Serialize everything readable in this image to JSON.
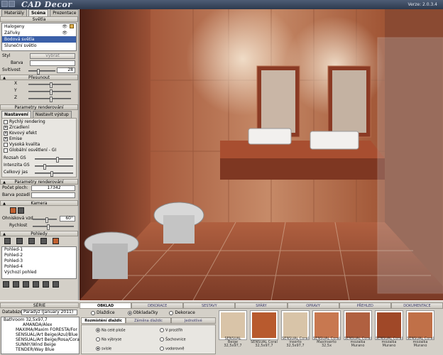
{
  "app": {
    "logo": "CAD Decor",
    "version": "Verze: 2.0.3.4"
  },
  "left": {
    "tabs": [
      {
        "label": "Materiály"
      },
      {
        "label": "Scéna"
      },
      {
        "label": "Prezentace"
      }
    ],
    "lights": {
      "header": "Světla",
      "items": [
        {
          "label": "Halogeny"
        },
        {
          "label": "Zářivky"
        },
        {
          "label": "Bodová světla"
        },
        {
          "label": "Sluneční světlo"
        }
      ]
    },
    "styl": {
      "label": "Styl",
      "button": "vybrat"
    },
    "barva": {
      "label": "Barva"
    },
    "svitivost": {
      "label": "Svítivost",
      "value": "28"
    },
    "presunout": {
      "header": "Přesunout",
      "x": "X",
      "y": "Y",
      "z": "Z"
    },
    "render": {
      "header": "Parametry renderování",
      "tab_settings": "Nastavení",
      "tab_output": "Nastavit výstup",
      "options": [
        {
          "label": "Rychlý rendering",
          "checked": false
        },
        {
          "label": "Zrcadlení",
          "checked": true
        },
        {
          "label": "Kovový efekt",
          "checked": true
        },
        {
          "label": "Emise",
          "checked": true
        },
        {
          "label": "Vysoká kvalita",
          "checked": false
        },
        {
          "label": "Globální osvětlení - GI",
          "checked": false
        }
      ],
      "rozsah": "Rozsah GS",
      "intenzita": "Intenzita GS",
      "celkovy": "Celkový jas"
    },
    "render2": {
      "header": "Parametry renderování",
      "pocet_label": "Počet ploch:",
      "pocet_value": "17342",
      "barva_pozadi": "Barva pozadí"
    },
    "kamera": {
      "header": "Kamera",
      "ohnisko_label": "Ohnisková vzd",
      "ohnisko_value": "60°",
      "rychlost": "Rychlost"
    },
    "pohledy": {
      "header": "Pohledy",
      "items": [
        {
          "label": "Pohled-1"
        },
        {
          "label": "Pohled-2"
        },
        {
          "label": "Pohled-3"
        },
        {
          "label": "Pohled-4"
        },
        {
          "label": "Výchozí pohled"
        }
      ]
    }
  },
  "bottom": {
    "serie_header": "SÉRIE",
    "databaze_label": "Databáze",
    "databaze_value": "Paradyz (January 2011)",
    "series": [
      {
        "label": "Bathroom 32,5x97,7"
      },
      {
        "label": "AMANDA/Alex"
      },
      {
        "label": "MAXIMA/Maxim FORESTA/For"
      },
      {
        "label": "SENSUAL/Art Beige/Azul/Blue"
      },
      {
        "label": "SENSUAL/Art Beige/Rosa/Cora"
      },
      {
        "label": "SUNNY/Wind Beige"
      },
      {
        "label": "TENDER/Way Blue"
      }
    ],
    "tabs": [
      {
        "label": "OBKLAD"
      },
      {
        "label": "DEKORACE"
      },
      {
        "label": "SESTAVY"
      },
      {
        "label": "SPÁRY"
      },
      {
        "label": "OPRAVY"
      },
      {
        "label": "PŘEHLED"
      },
      {
        "label": "DOKUMENTACE"
      }
    ],
    "subtabs": {
      "dlazdice": "Dlaždice",
      "obkladacky": "Obkladačky",
      "dekorace": "Dekorace"
    },
    "layout_tabs": {
      "rozmisteni": "Rozmístění dlaždic",
      "zamena": "Záměna dlaždic",
      "jednotlive": "Jednotlivé"
    },
    "layout_options": [
      {
        "label": "Na celé ploše",
        "on": true
      },
      {
        "label": "Na výbryse",
        "on": false
      },
      {
        "label": "svisle",
        "on": true
      },
      {
        "label": "V prostřih",
        "on": false
      },
      {
        "label": "Šachovnice",
        "on": false
      },
      {
        "label": "vodorovně",
        "on": false
      }
    ],
    "swatches": [
      {
        "name": "SENSUAL Beige 32,5x97,7",
        "color": "#d9c4a8"
      },
      {
        "name": "SENSUAL Coral 32,5x97,7",
        "color": "#b85a2e"
      },
      {
        "name": "SENSUAL Coral inserto 32,5x97,7",
        "color": "#d8c4a8"
      },
      {
        "name": "SENSUAL Coral Maxinserto 32,5x",
        "color": "#c87850"
      },
      {
        "name": "SENSUAL Coral mozaika Murano",
        "color": "#b06040"
      },
      {
        "name": "SENSUAL Coral mozaika Murano",
        "color": "#a04828"
      },
      {
        "name": "SENSUAL Coral mozaika Murano",
        "color": "#c07048"
      }
    ]
  }
}
